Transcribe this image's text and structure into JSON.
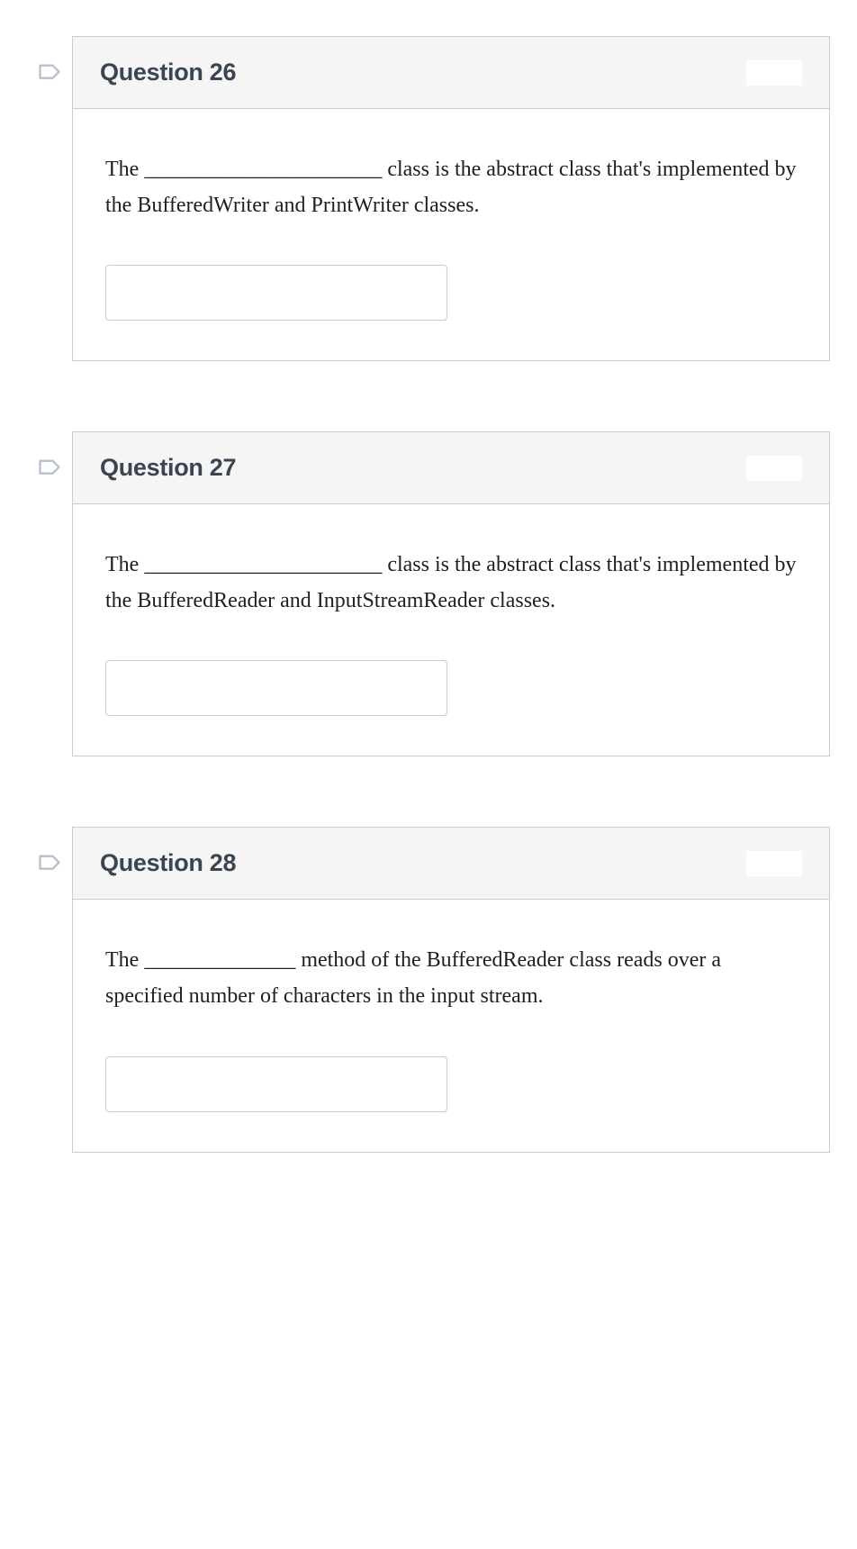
{
  "questions": [
    {
      "title": "Question 26",
      "prompt": "The ______________________ class is the abstract class that's implemented by the BufferedWriter and PrintWriter classes.",
      "answer": ""
    },
    {
      "title": "Question 27",
      "prompt": "The ______________________ class is the abstract class that's implemented by the BufferedReader and InputStreamReader classes.",
      "answer": ""
    },
    {
      "title": "Question 28",
      "prompt": "The ______________ method of the BufferedReader class reads over a specified number of characters in the input stream.",
      "answer": ""
    }
  ]
}
